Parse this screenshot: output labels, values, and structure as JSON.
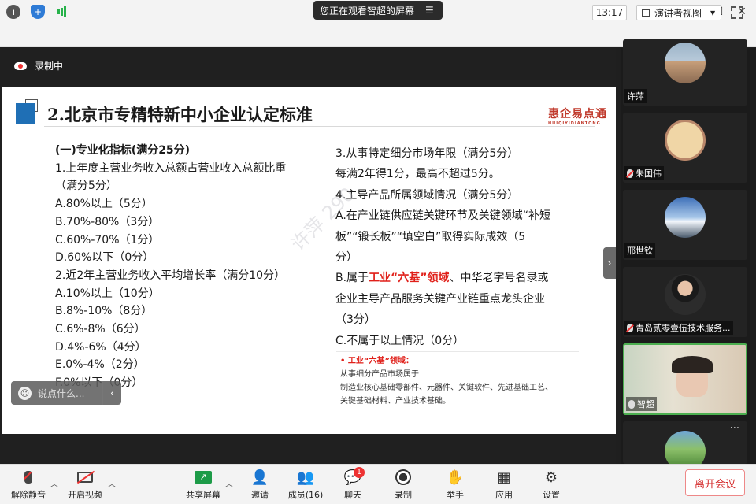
{
  "banner": {
    "text": "您正在观看智超的屏幕",
    "menu_icon": "menu-icon"
  },
  "toolbar": {
    "time": "13:17",
    "view_label": "演讲者视图"
  },
  "recording": {
    "label": "录制中"
  },
  "slide": {
    "title": "2.北京市专精特新中小企业认定标准",
    "brand": "惠企易点通",
    "brand_sub": "HUIQIYIDIANTONG",
    "left_lines": [
      "(一)专业化指标(满分25分)",
      "1.上年度主营业务收入总额占营业收入总额比重",
      "（满分5分）",
      "A.80%以上（5分）",
      "B.70%-80%（3分）",
      "C.60%-70%（1分）",
      "D.60%以下（0分）",
      "2.近2年主营业务收入平均增长率（满分10分）",
      "A.10%以上（10分）",
      "B.8%-10%（8分）",
      "C.6%-8%（6分）",
      "D.4%-6%（4分）",
      "E.0%-4%（2分）",
      "F.0%以下（0分）"
    ],
    "right_lines": [
      "3.从事特定细分市场年限（满分5分）",
      "每满2年得1分，最高不超过5分。",
      "4.主导产品所属领域情况（满分5分）",
      "A.在产业链供应链关键环节及关键领域“补短",
      "板”“锻长板”“填空白”取得实际成效（5",
      "分）"
    ],
    "right_b_prefix": "B.属于",
    "right_b_red": "工业“六基”领域",
    "right_b_suffix": "、中华老字号名录或",
    "right_b_line2": "企业主导产品服务关键产业链重点龙头企业",
    "right_b_line3": "（3分）",
    "right_c": "C.不属于以上情况（0分）",
    "note_title": "•   工业“六基”领域：",
    "note_lines": [
      "从事细分产品市场属于",
      "制造业核心基础零部件、元器件、关键软件、先进基础工艺、",
      "关键基础材料、产业技术基础。"
    ],
    "watermark": "许萍 290"
  },
  "comment": {
    "placeholder": "说点什么..."
  },
  "participants": [
    {
      "name": "许萍",
      "muted": false
    },
    {
      "name": "朱国伟",
      "muted": true
    },
    {
      "name": "邢世钦",
      "muted": false
    },
    {
      "name": "青岛贰零壹伍技术服务...",
      "muted": true
    },
    {
      "name": "智超",
      "muted": false
    }
  ],
  "more_icon": "more-icon",
  "bottom": {
    "mute": "解除静音",
    "video": "开启视频",
    "share": "共享屏幕",
    "invite": "邀请",
    "members": "成员(16)",
    "chat": "聊天",
    "chat_count": "1",
    "record": "录制",
    "raise_hand": "举手",
    "apps": "应用",
    "settings": "设置",
    "leave": "离开会议"
  },
  "colors": {
    "accent_blue": "#1f6fb5",
    "alert_red": "#e0201a",
    "active_green": "#4caf50"
  }
}
